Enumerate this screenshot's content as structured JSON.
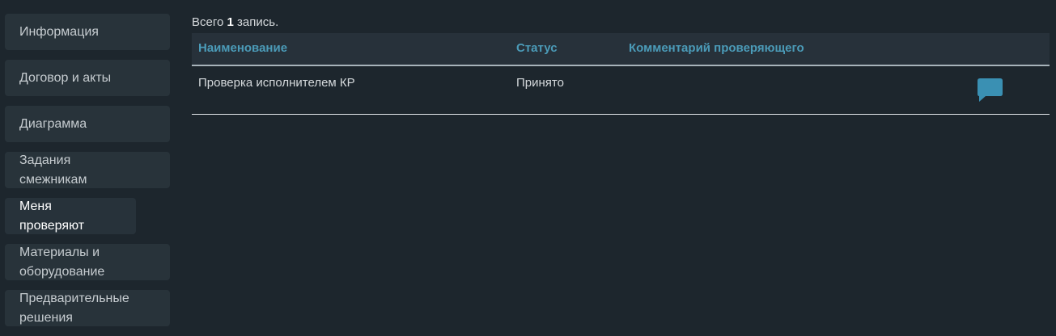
{
  "sidebar": {
    "items": [
      {
        "label": "Информация"
      },
      {
        "label": "Договор и акты"
      },
      {
        "label": "Диаграмма"
      },
      {
        "label": "Задания смежникам"
      },
      {
        "label": "Меня проверяют"
      },
      {
        "label": "Материалы и оборудование"
      },
      {
        "label": "Предварительные решения"
      }
    ]
  },
  "main": {
    "total_prefix": "Всего",
    "total_count": "1",
    "total_suffix": "запись.",
    "table": {
      "headers": [
        "Наименование",
        "Статус",
        "Комментарий проверяющего"
      ],
      "rows": [
        {
          "name": "Проверка исполнителем КР",
          "status": "Принято",
          "comment": "",
          "action_icon": "comment-icon"
        }
      ]
    }
  },
  "colors": {
    "background": "#1d262d",
    "panel": "#28333a",
    "accent": "#4b9bb8",
    "text": "#d5d9dc"
  }
}
